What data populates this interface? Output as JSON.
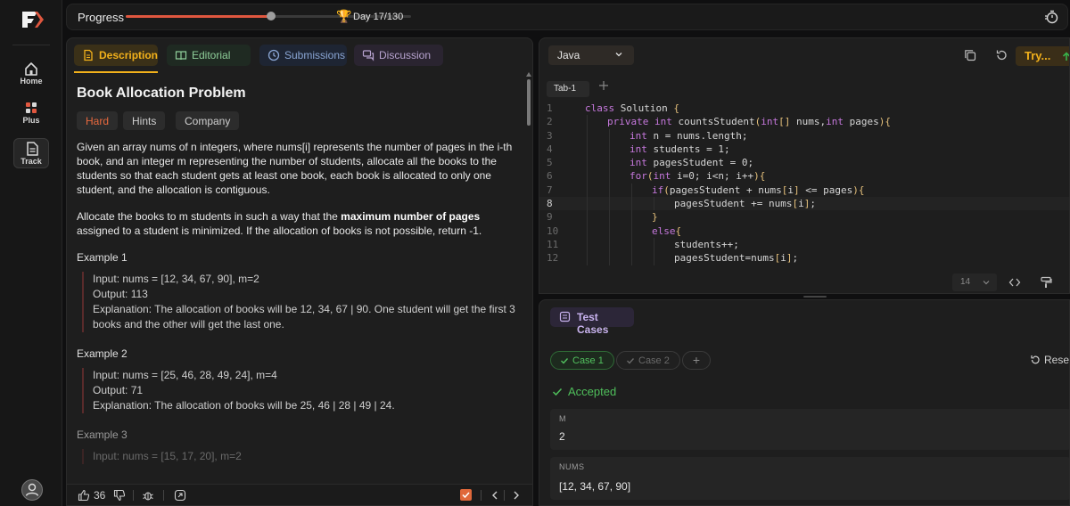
{
  "progress": {
    "label": "Progress",
    "fraction": 0.51,
    "day_label": "Day 17/130"
  },
  "rail": {
    "items": [
      {
        "label": "Home"
      },
      {
        "label": "Plus"
      },
      {
        "label": "Track"
      }
    ]
  },
  "tabs": {
    "description": "Description",
    "editorial": "Editorial",
    "submissions": "Submissions",
    "discussion": "Discussion"
  },
  "problem": {
    "title": "Book Allocation Problem",
    "difficulty": "Hard",
    "hints": "Hints",
    "company": "Company",
    "para1": "Given an array nums of n integers, where nums[i] represents the number of pages in the i-th book, and an integer m representing the number of students, allocate all the books to the students so that each student gets at least one book, each book is allocated to only one student, and the allocation is contiguous.",
    "para2_pre": "Allocate the books to m students in such a way that the ",
    "para2_bold": "maximum number of pages",
    "para2_post": " assigned to a student is minimized. If the allocation of books is not possible, return -1.",
    "examples": [
      {
        "title": "Example 1",
        "input": "Input: nums = [12, 34, 67, 90], m=2",
        "output": "Output: 113",
        "explanation": "Explanation: The allocation of books will be 12, 34, 67 | 90. One student will get the first 3 books and the other will get the last one."
      },
      {
        "title": "Example 2",
        "input": "Input: nums = [25, 46, 28, 49, 24], m=4",
        "output": "Output: 71",
        "explanation": "Explanation: The allocation of books will be 25, 46 | 28 | 49 | 24."
      },
      {
        "title": "Example 3",
        "input": "Input: nums = [15, 17, 20], m=2"
      }
    ]
  },
  "footer": {
    "likes": "36"
  },
  "editor": {
    "language": "Java",
    "try_label": "Try...",
    "file_tab": "Tab-1",
    "font_size": "14",
    "active_line": 8,
    "lines": [
      {
        "n": "1",
        "indent": 0,
        "code": "class Solution {"
      },
      {
        "n": "2",
        "indent": 1,
        "code": "private int countsStudent(int[] nums,int pages){"
      },
      {
        "n": "3",
        "indent": 2,
        "code": "int n = nums.length;"
      },
      {
        "n": "4",
        "indent": 2,
        "code": "int students = 1;"
      },
      {
        "n": "5",
        "indent": 2,
        "code": "int pagesStudent = 0;"
      },
      {
        "n": "6",
        "indent": 2,
        "code": "for(int i=0; i<n; i++){"
      },
      {
        "n": "7",
        "indent": 3,
        "code": "if(pagesStudent + nums[i] <= pages){"
      },
      {
        "n": "8",
        "indent": 4,
        "code": "pagesStudent += nums[i];"
      },
      {
        "n": "9",
        "indent": 3,
        "code": "}"
      },
      {
        "n": "10",
        "indent": 3,
        "code": "else{"
      },
      {
        "n": "11",
        "indent": 4,
        "code": "students++;"
      },
      {
        "n": "12",
        "indent": 4,
        "code": "pagesStudent=nums[i];"
      }
    ]
  },
  "tests": {
    "title": "Test Cases",
    "case1": "Case 1",
    "case2": "Case 2",
    "add": "+",
    "reset": "Reset",
    "status": "Accepted",
    "fields": [
      {
        "label": "M",
        "value": "2"
      },
      {
        "label": "NUMS",
        "value": "[12, 34, 67, 90]"
      }
    ]
  },
  "colors": {
    "accent": "#f2b11b",
    "progress_fill": "#e0573f",
    "hard": "#e8693e",
    "accepted": "#4fbf5b",
    "test_title": "#c9b3ef"
  }
}
